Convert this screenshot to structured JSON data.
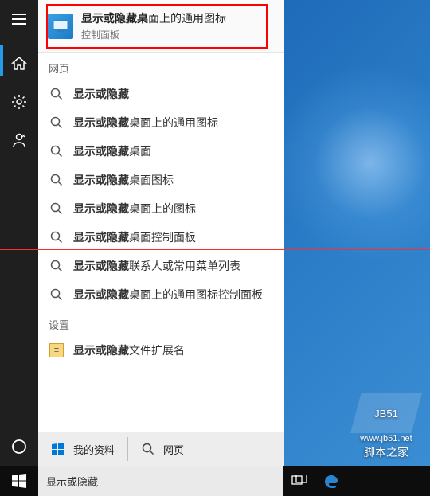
{
  "bestMatch": {
    "title_bold": "显示或隐藏桌",
    "title_rest": "面上的通用图标",
    "subtitle": "控制面板"
  },
  "sections": {
    "web": "网页",
    "settings": "设置"
  },
  "webResults": [
    {
      "bold": "显示或隐藏",
      "rest": ""
    },
    {
      "bold": "显示或隐藏",
      "rest": "桌面上的通用图标"
    },
    {
      "bold": "显示或隐藏",
      "rest": "桌面"
    },
    {
      "bold": "显示或隐藏",
      "rest": "桌面图标"
    },
    {
      "bold": "显示或隐藏",
      "rest": "桌面上的图标"
    },
    {
      "bold": "显示或隐藏",
      "rest": "桌面控制面板"
    },
    {
      "bold": "显示或隐藏",
      "rest": "联系人或常用菜单列表"
    },
    {
      "bold": "显示或隐藏",
      "rest": "桌面上的通用图标控制面板"
    }
  ],
  "settingsResults": [
    {
      "bold": "显示或隐藏",
      "rest": "文件扩展名"
    }
  ],
  "filters": {
    "tab1": "我的资料",
    "tab2": "网页"
  },
  "search": {
    "value": "显示或隐藏"
  },
  "watermark": {
    "url": "www.jb51.net",
    "cn": "脚本之家",
    "logo": "JB51"
  }
}
